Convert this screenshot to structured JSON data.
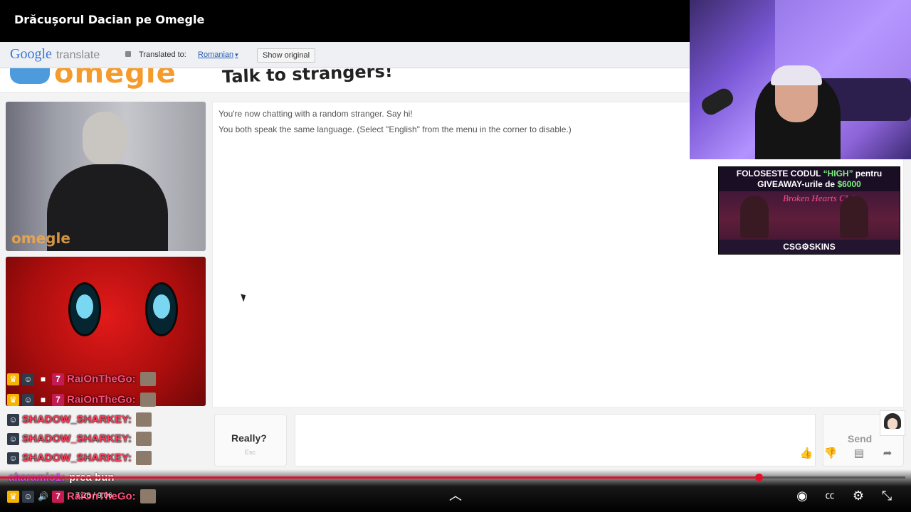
{
  "video": {
    "title": "Drăcușorul Dacian pe Omegle",
    "time": "7:26 / 9:06",
    "progress_fraction": 0.838
  },
  "translate_bar": {
    "logo_google": "Google",
    "logo_translate": "translate",
    "translated_to_label": "Translated to:",
    "language": "Romanian",
    "show_original": "Show original"
  },
  "omegle": {
    "logo": "omegle",
    "slogan": "Talk to strangers!",
    "webcam_watermark": "omegle",
    "chat_lines": [
      "You're now chatting with a random stranger. Say hi!",
      "You both speak the same language. (Select \"English\" from the menu in the corner to disable.)"
    ],
    "really_button": "Really?",
    "really_hint": "Esc",
    "send_button": "Send"
  },
  "sponsor": {
    "line1_pre": "FOLOSESTE CODUL ",
    "line1_code": "“HIGH”",
    "line1_post": " pentru",
    "line2_pre": "GIVEAWAY-urile de ",
    "line2_amount": "$6000",
    "brand": "CSG⚙SKINS",
    "sign": "Broken Hearts Club"
  },
  "stream_chat": [
    {
      "user": "RaiOnTheGo:",
      "color": "#ff4f7c"
    },
    {
      "user": "RaiOnTheGo:",
      "color": "#ff4f7c"
    },
    {
      "user": "SHADOW_SHARKEY:",
      "color": "#ff3d5a"
    },
    {
      "user": "SHADOW_SHARKEY:",
      "color": "#ff3d5a"
    },
    {
      "user": "SHADOW_SHARKEY:",
      "color": "#ff3d5a"
    }
  ],
  "last_message": {
    "user": "akaramio1:",
    "text": "prea bun"
  },
  "bottom_chat_user": "RaiOnTheGo:",
  "colors": {
    "accent_red": "#e0102b",
    "omegle_orange": "#f49b2b",
    "ad_highlight": "#7ef57e"
  },
  "icons": {
    "like": "thumbs-up-icon",
    "dislike": "thumbs-down-icon",
    "comments": "comment-icon",
    "share": "share-icon",
    "autoplay": "toggle-icon",
    "captions": "cc-icon",
    "settings": "gear-icon",
    "fullscreen": "exit-fullscreen-icon",
    "expand": "chevron-up-icon"
  }
}
